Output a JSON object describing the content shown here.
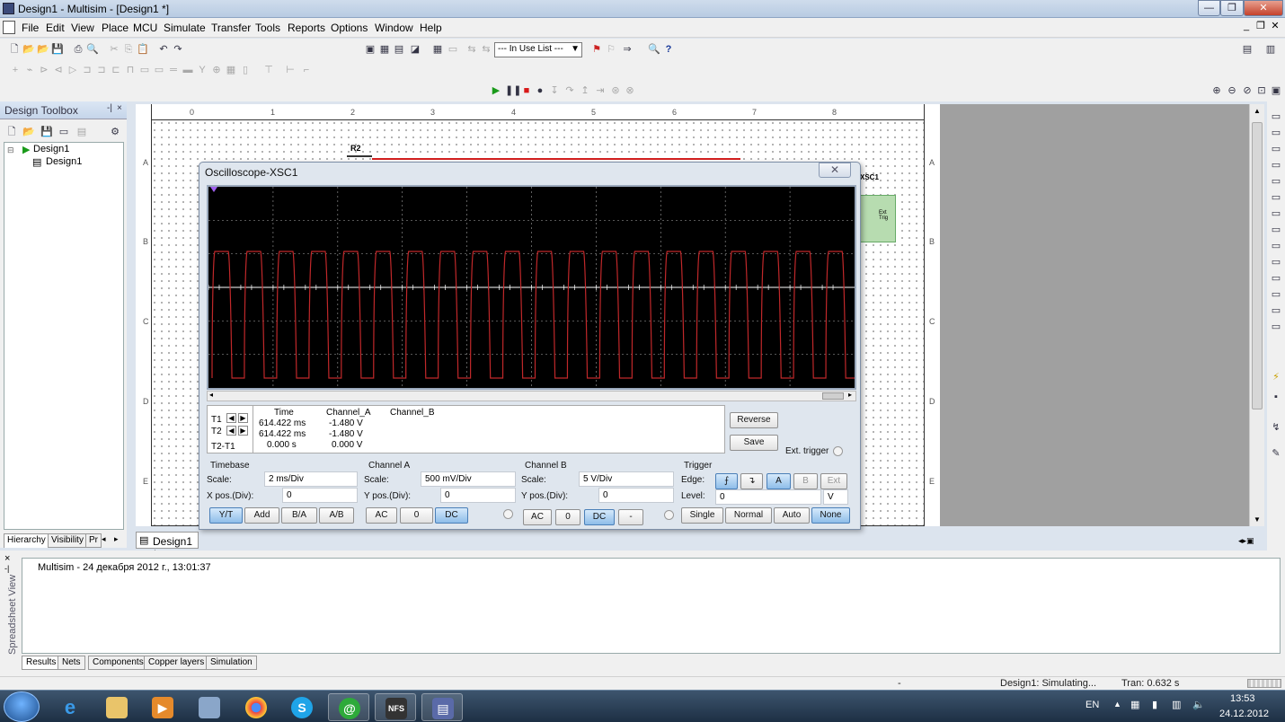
{
  "window": {
    "title": "Design1 - Multisim - [Design1 *]"
  },
  "menu": [
    "File",
    "Edit",
    "View",
    "Place",
    "MCU",
    "Simulate",
    "Transfer",
    "Tools",
    "Reports",
    "Options",
    "Window",
    "Help"
  ],
  "toolbar": {
    "in_use_list": "--- In Use List ---"
  },
  "toolbox": {
    "title": "Design Toolbox",
    "tree": [
      "Design1",
      "Design1"
    ],
    "tabs": [
      "Hierarchy",
      "Visibility",
      "Pr"
    ]
  },
  "schematic": {
    "component_label": "R2",
    "instrument_label": "XSC1",
    "ext_trig_label": "Ext Trig",
    "ruler_numbers": [
      "0",
      "1",
      "2",
      "3",
      "4",
      "5",
      "6",
      "7",
      "8"
    ],
    "ruler_letters": [
      "A",
      "B",
      "C",
      "D",
      "E"
    ],
    "tab_label": "Design1 *"
  },
  "oscilloscope": {
    "title": "Oscilloscope-XSC1",
    "readout": {
      "headers": [
        "Time",
        "Channel_A",
        "Channel_B"
      ],
      "rows": [
        {
          "label": "T1",
          "time": "614.422 ms",
          "a": "-1.480 V",
          "b": ""
        },
        {
          "label": "T2",
          "time": "614.422 ms",
          "a": "-1.480 V",
          "b": ""
        },
        {
          "label": "T2-T1",
          "time": "0.000 s",
          "a": "0.000 V",
          "b": ""
        }
      ]
    },
    "buttons": {
      "reverse": "Reverse",
      "save": "Save",
      "ext_trigger": "Ext. trigger"
    },
    "timebase": {
      "title": "Timebase",
      "scale_label": "Scale:",
      "scale": "2 ms/Div",
      "xpos_label": "X pos.(Div):",
      "xpos": "0",
      "modes": [
        "Y/T",
        "Add",
        "B/A",
        "A/B"
      ]
    },
    "channel_a": {
      "title": "Channel A",
      "scale_label": "Scale:",
      "scale": "500 mV/Div",
      "ypos_label": "Y pos.(Div):",
      "ypos": "0",
      "coupling": [
        "AC",
        "0",
        "DC"
      ]
    },
    "channel_b": {
      "title": "Channel B",
      "scale_label": "Scale:",
      "scale": "5  V/Div",
      "ypos_label": "Y pos.(Div):",
      "ypos": "0",
      "coupling": [
        "AC",
        "0",
        "DC",
        "-"
      ]
    },
    "trigger": {
      "title": "Trigger",
      "edge_label": "Edge:",
      "sources": [
        "A",
        "B",
        "Ext"
      ],
      "level_label": "Level:",
      "level": "0",
      "level_unit": "V",
      "modes": [
        "Single",
        "Normal",
        "Auto",
        "None"
      ]
    },
    "waveform": {
      "pulses": 20,
      "color": "#c0282a",
      "trace_color": "#ffffff"
    }
  },
  "spreadsheet": {
    "title": "Spreadsheet View",
    "log": "Multisim  -  24 декабря 2012 г., 13:01:37",
    "tabs": [
      "Results",
      "Nets",
      "Components",
      "Copper layers",
      "Simulation"
    ]
  },
  "status": {
    "dash": "-",
    "simulating": "Design1: Simulating...",
    "tran": "Tran: 0.632 s"
  },
  "taskbar": {
    "lang": "EN",
    "time": "13:53",
    "date": "24.12.2012"
  }
}
